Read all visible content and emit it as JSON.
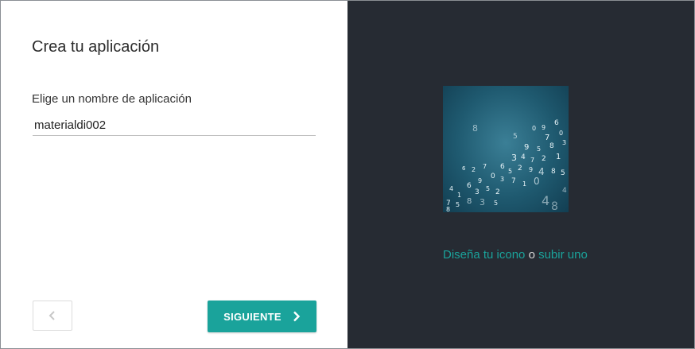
{
  "dialog": {
    "title": "Crea tu aplicación",
    "name_label": "Elige un nombre de aplicación",
    "name_value": "materialdi002",
    "back_icon": "chevron-left-icon",
    "next_label": "SIGUIENTE",
    "next_icon": "chevron-right-icon"
  },
  "icon_panel": {
    "design_link": "Diseña tu icono",
    "separator": "o",
    "upload_link": "subir uno"
  },
  "colors": {
    "accent": "#1aa39b",
    "panel_background": "#262b33",
    "back_button_border": "#dcdcdc"
  }
}
